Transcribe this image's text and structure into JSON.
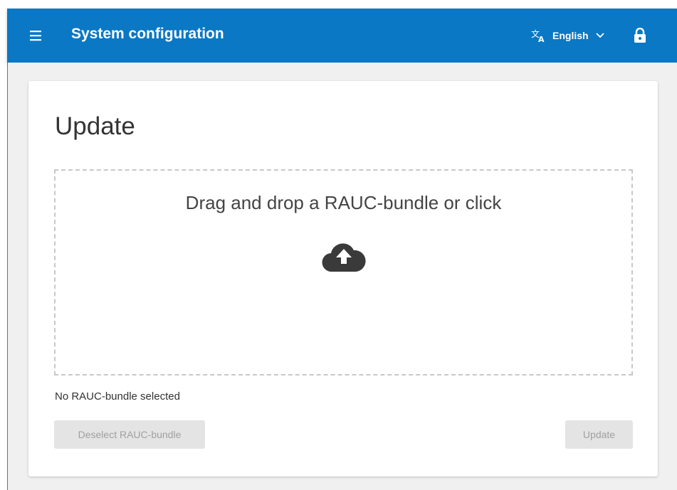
{
  "header": {
    "title": "System configuration",
    "language": "English",
    "accent_color": "#0a78c4"
  },
  "icons": {
    "menu": "hamburger-icon",
    "translate": "translate-icon",
    "chevron": "chevron-down-icon",
    "lock": "lock-icon",
    "upload": "cloud-upload-icon"
  },
  "main": {
    "title": "Update",
    "dropzone_text": "Drag and drop a RAUC-bundle or click",
    "status_text": "No RAUC-bundle selected",
    "deselect_label": "Deselect RAUC-bundle",
    "update_label": "Update"
  }
}
